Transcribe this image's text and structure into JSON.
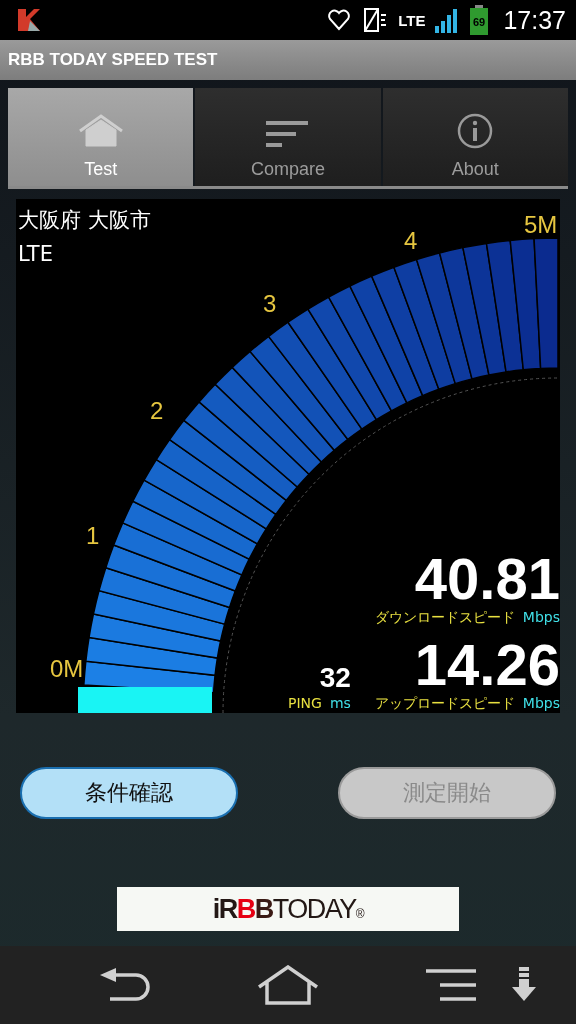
{
  "status_bar": {
    "network": "LTE",
    "battery": "69",
    "time": "17:37"
  },
  "app_bar": {
    "title": "RBB TODAY SPEED TEST"
  },
  "tabs": [
    {
      "label": "Test",
      "selected": true
    },
    {
      "label": "Compare",
      "selected": false
    },
    {
      "label": "About",
      "selected": false
    }
  ],
  "location": "大阪府 大阪市",
  "network_type": "LTE",
  "gauge": {
    "scale_labels": [
      "0M",
      "1",
      "2",
      "3",
      "4",
      "5M"
    ]
  },
  "download": {
    "value": "40.81",
    "label": "ダウンロードスピード",
    "unit": "Mbps"
  },
  "ping": {
    "value": "32",
    "label": "PING",
    "unit": "ms"
  },
  "upload": {
    "value": "14.26",
    "label": "アップロードスピード",
    "unit": "Mbps"
  },
  "buttons": [
    {
      "label": "条件確認",
      "disabled": false
    },
    {
      "label": "測定開始",
      "disabled": true
    }
  ],
  "banner": {
    "logo_parts": [
      {
        "text": "iR",
        "color": "#231815"
      },
      {
        "text": "B",
        "color": "#e60012"
      },
      {
        "text": "B",
        "color": "#3a1a14"
      },
      {
        "text": "TODAY",
        "color": "#231815"
      },
      {
        "text": "®",
        "kind": "mark"
      }
    ]
  }
}
